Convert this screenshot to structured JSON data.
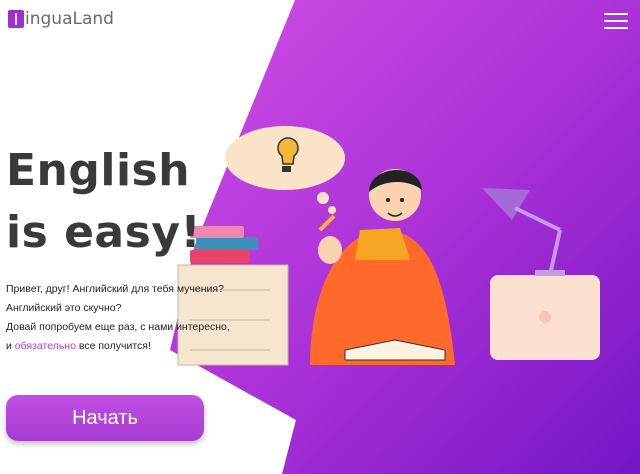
{
  "brand": {
    "logo_text": "inguaLand"
  },
  "hero": {
    "headline_line1": "English",
    "headline_line2": "is easy!",
    "intro": {
      "line1": "Привет, друг! Английский для тебя мучения?",
      "line2": "Английский это скучно?",
      "line3": "Довай попробуем еще раз, с нами интересно,",
      "line4_pre": "и ",
      "line4_accent": "обязательно",
      "line4_post": " все получится!"
    },
    "cta_label": "Начать"
  },
  "colors": {
    "accent": "#b63de0",
    "background_gradient": [
      "#d14fe6",
      "#7a19c8"
    ],
    "headline": "#3a3a3a"
  },
  "icons": [
    "logo-mark-icon",
    "hamburger-menu-icon",
    "lightbulb-icon"
  ]
}
